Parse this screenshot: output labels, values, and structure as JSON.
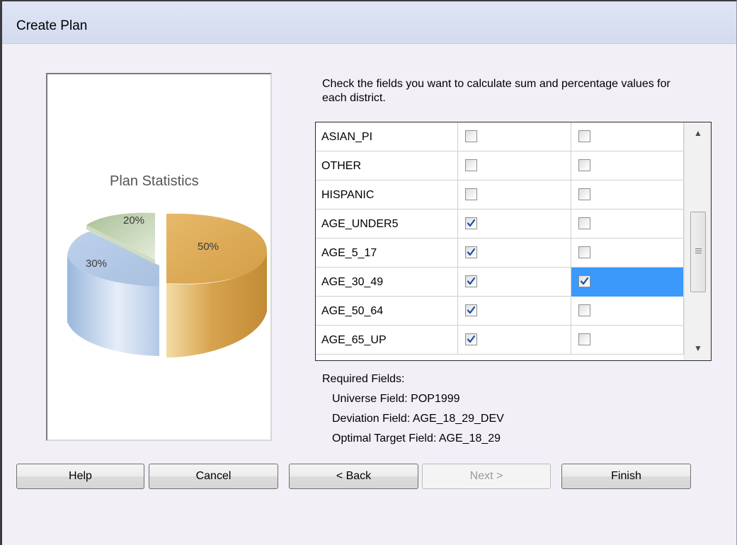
{
  "window": {
    "title": "Create Plan"
  },
  "preview": {
    "chart_data": {
      "type": "pie",
      "title": "Plan Statistics",
      "slices": [
        {
          "label": "50%",
          "value": 50,
          "color": "#d6a24c"
        },
        {
          "label": "30%",
          "value": 30,
          "color": "#b8cde6"
        },
        {
          "label": "20%",
          "value": 20,
          "color": "#9bb48a"
        }
      ]
    }
  },
  "instructions": "Check the fields you want to calculate sum and percentage values for each district.",
  "fields": [
    {
      "name": "ASIAN_PI",
      "sum": false,
      "pct": false
    },
    {
      "name": "OTHER",
      "sum": false,
      "pct": false
    },
    {
      "name": "HISPANIC",
      "sum": false,
      "pct": false
    },
    {
      "name": "AGE_UNDER5",
      "sum": true,
      "pct": false
    },
    {
      "name": "AGE_5_17",
      "sum": true,
      "pct": false
    },
    {
      "name": "AGE_30_49",
      "sum": true,
      "pct": true,
      "selected": true
    },
    {
      "name": "AGE_50_64",
      "sum": true,
      "pct": false
    },
    {
      "name": "AGE_65_UP",
      "sum": true,
      "pct": false
    }
  ],
  "required": {
    "heading": "Required Fields:",
    "universe": "Universe Field: POP1999",
    "deviation": "Deviation Field: AGE_18_29_DEV",
    "target": "Optimal Target Field: AGE_18_29"
  },
  "buttons": {
    "help": "Help",
    "cancel": "Cancel",
    "back": "< Back",
    "next": "Next >",
    "finish": "Finish"
  },
  "icons": {
    "scroll_up": "scroll-up-arrow-icon",
    "scroll_down": "scroll-down-arrow-icon",
    "check": "checkmark-icon"
  },
  "colors": {
    "selection": "#3b99fc",
    "check": "#1c4ea8"
  }
}
